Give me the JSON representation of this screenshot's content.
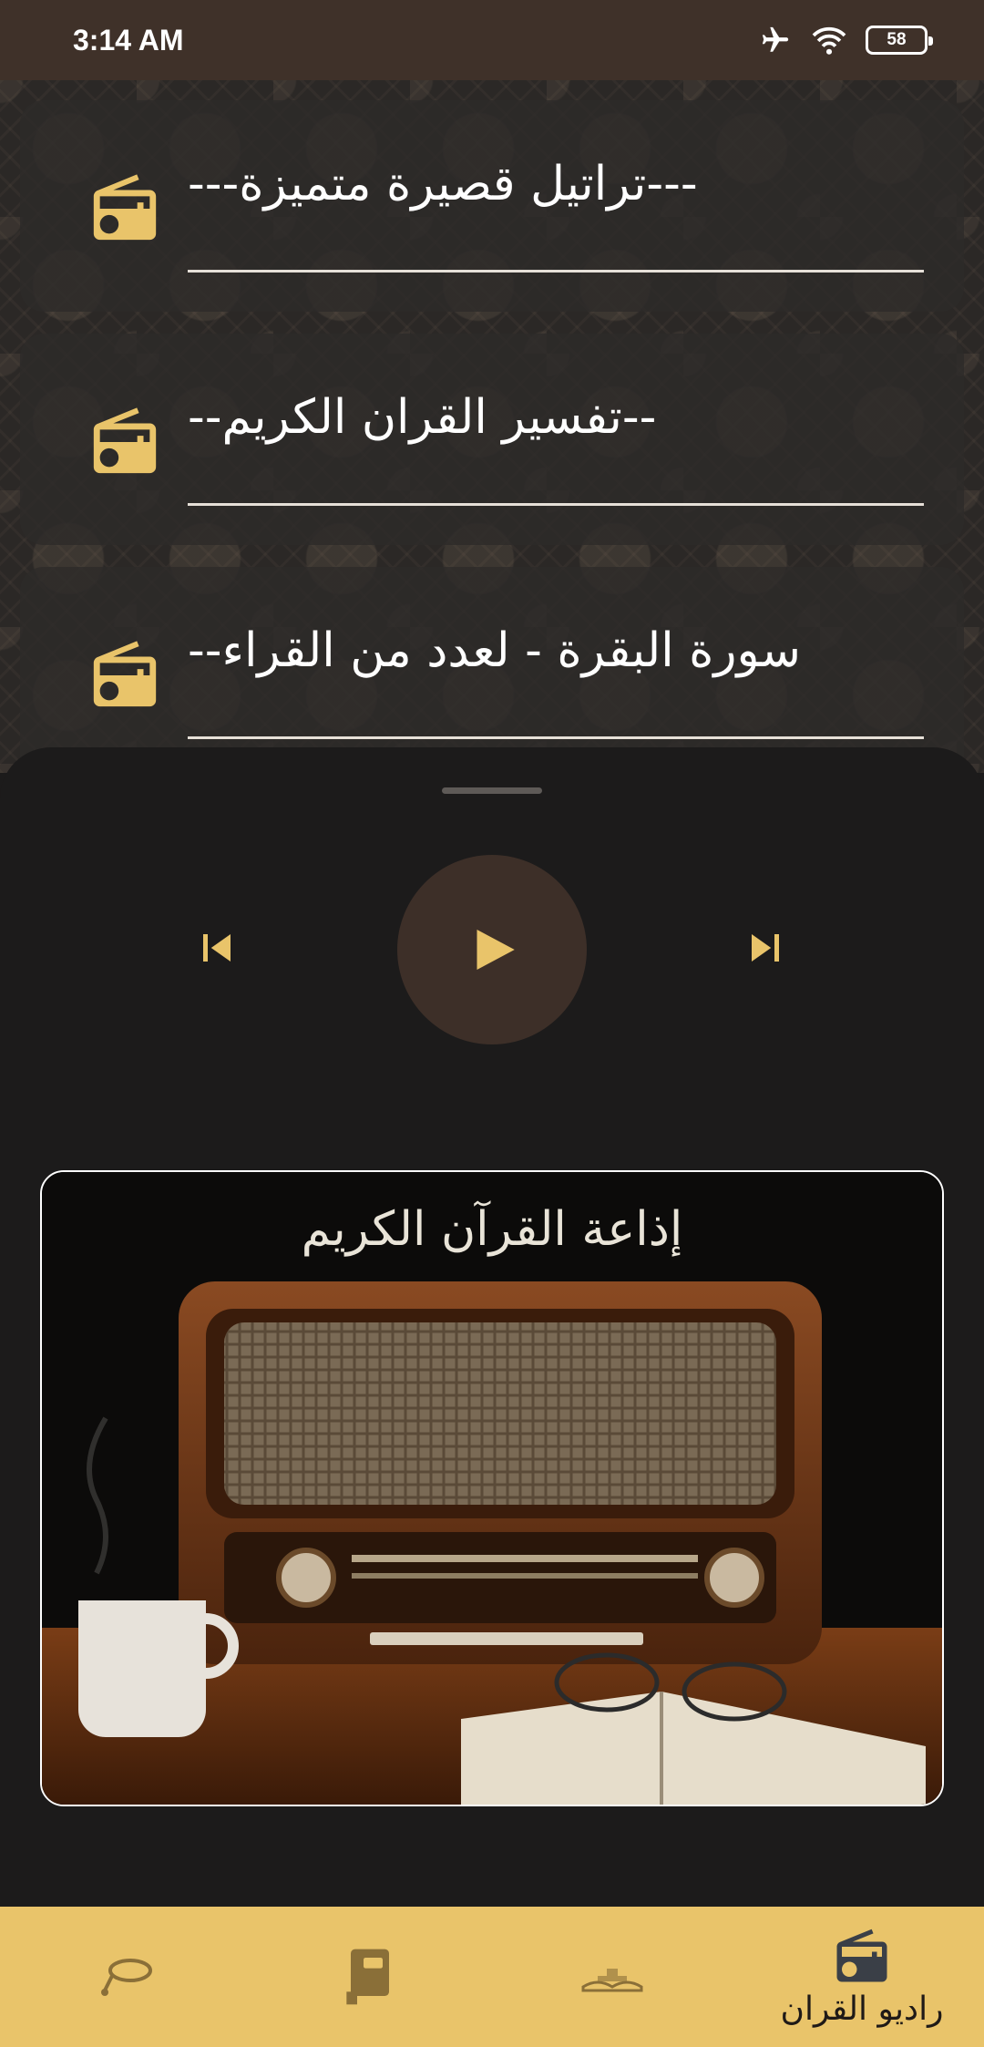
{
  "status_bar": {
    "time": "3:14 AM",
    "battery_level": "58",
    "icons": [
      "airplane-mode-icon",
      "wifi-icon",
      "battery-icon"
    ]
  },
  "stations": [
    {
      "name": "---تراتيل قصيرة متميزة---",
      "icon": "radio-icon"
    },
    {
      "name": "--تفسير القران الكريم--",
      "icon": "radio-icon"
    },
    {
      "name": "--سورة البقرة - لعدد من القراء",
      "icon": "radio-icon"
    }
  ],
  "player": {
    "controls": [
      "skip-previous-icon",
      "play-icon",
      "skip-next-icon"
    ],
    "image": {
      "heading": "إذاعة القرآن الكريم"
    }
  },
  "bottom_nav": {
    "items": [
      {
        "icon": "tasbeeh-icon",
        "label": ""
      },
      {
        "icon": "book-icon",
        "label": ""
      },
      {
        "icon": "quran-icon",
        "label": ""
      },
      {
        "icon": "radio-icon",
        "label": "راديو القران",
        "selected": true
      }
    ]
  },
  "colors": {
    "accent_gold": "#e9c46a",
    "status_bar_brown": "#3f3129",
    "play_button_brown": "#3d2f28",
    "background_dark": "#1c1b1b"
  }
}
